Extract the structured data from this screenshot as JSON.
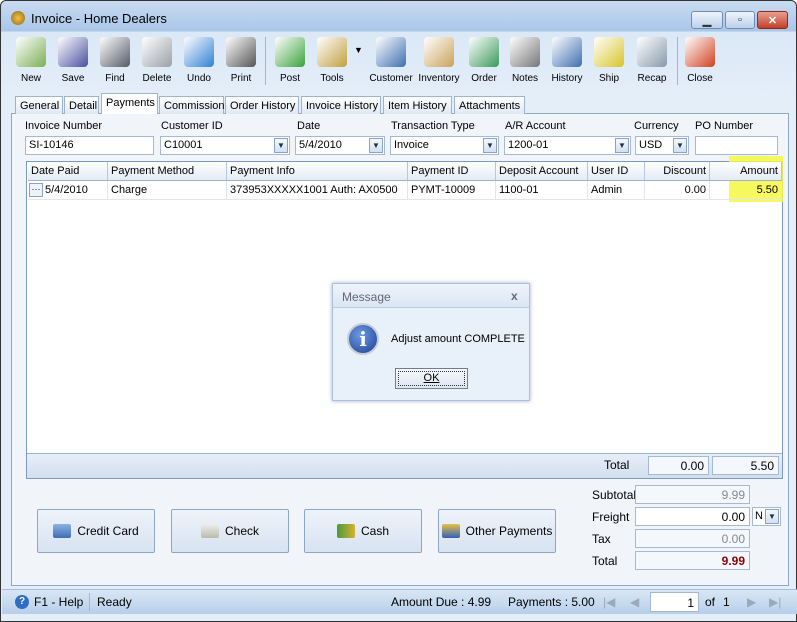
{
  "window": {
    "title": "Invoice - Home Dealers",
    "controls": [
      "minimize",
      "maximize",
      "close"
    ]
  },
  "toolbar": [
    {
      "label": "New",
      "icon": "new-document-icon",
      "color": "#7cae55"
    },
    {
      "label": "Save",
      "icon": "floppy-disk-icon",
      "color": "#4b4fa0"
    },
    {
      "label": "Find",
      "icon": "binoculars-icon",
      "color": "#555a66"
    },
    {
      "label": "Delete",
      "icon": "recycle-bin-icon",
      "color": "#9aa0a6"
    },
    {
      "label": "Undo",
      "icon": "undo-arrow-icon",
      "color": "#2f80d6"
    },
    {
      "label": "Print",
      "icon": "printer-icon",
      "color": "#555"
    },
    {
      "label": "Post",
      "icon": "post-check-icon",
      "color": "#3aa23a"
    },
    {
      "label": "Tools",
      "icon": "tools-icon",
      "color": "#c0a040"
    },
    {
      "label": "Customer",
      "icon": "customer-icon",
      "color": "#3d6fb0"
    },
    {
      "label": "Inventory",
      "icon": "boxes-icon",
      "color": "#c9a25a"
    },
    {
      "label": "Order",
      "icon": "handheld-order-icon",
      "color": "#3a9a5a"
    },
    {
      "label": "Notes",
      "icon": "notepad-pen-icon",
      "color": "#777"
    },
    {
      "label": "History",
      "icon": "history-hourglass-icon",
      "color": "#3d6fb0"
    },
    {
      "label": "Ship",
      "icon": "forklift-icon",
      "color": "#d8c42a"
    },
    {
      "label": "Recap",
      "icon": "recap-sheet-icon",
      "color": "#8899aa"
    },
    {
      "label": "Close",
      "icon": "close-window-icon",
      "color": "#d04020"
    }
  ],
  "tabs": [
    "General",
    "Detail",
    "Payments",
    "Commission",
    "Order History",
    "Invoice History",
    "Item History",
    "Attachments"
  ],
  "active_tab": "Payments",
  "header": {
    "invoice_number": {
      "label": "Invoice Number",
      "value": "SI-10146"
    },
    "customer_id": {
      "label": "Customer ID",
      "value": "C10001"
    },
    "date": {
      "label": "Date",
      "value": "5/4/2010"
    },
    "transaction_type": {
      "label": "Transaction Type",
      "value": "Invoice"
    },
    "ar_account": {
      "label": "A/R Account",
      "value": "1200-01"
    },
    "currency": {
      "label": "Currency",
      "value": "USD"
    },
    "po_number": {
      "label": "PO Number",
      "value": ""
    }
  },
  "grid": {
    "columns": [
      "Date Paid",
      "Payment Method",
      "Payment Info",
      "Payment ID",
      "Deposit Account",
      "User ID",
      "Discount",
      "Amount"
    ],
    "rows": [
      [
        "5/4/2010",
        "Charge",
        "373953XXXXX1001 Auth: AX0500",
        "PYMT-10009",
        "1100-01",
        "Admin",
        "0.00",
        "5.50"
      ]
    ],
    "highlight_color": "#f4f742",
    "total": {
      "label": "Total",
      "discount": "0.00",
      "amount": "5.50"
    }
  },
  "dialog": {
    "title": "Message",
    "message": "Adjust amount COMPLETE",
    "ok": "OK",
    "close": "x",
    "icon": "info-icon"
  },
  "payment_buttons": [
    "Credit Card",
    "Check",
    "Cash",
    "Other Payments"
  ],
  "totals": {
    "subtotal": {
      "label": "Subtotal",
      "value": "9.99"
    },
    "freight": {
      "label": "Freight",
      "value": "0.00",
      "option": "N"
    },
    "tax": {
      "label": "Tax",
      "value": "0.00"
    },
    "total": {
      "label": "Total",
      "value": "9.99",
      "color": "#8b0000"
    }
  },
  "status": {
    "help": "F1 - Help",
    "state": "Ready",
    "amount_due": "Amount Due : 4.99",
    "payments": "Payments : 5.00",
    "page": "1",
    "of": "of",
    "pages": "1"
  }
}
